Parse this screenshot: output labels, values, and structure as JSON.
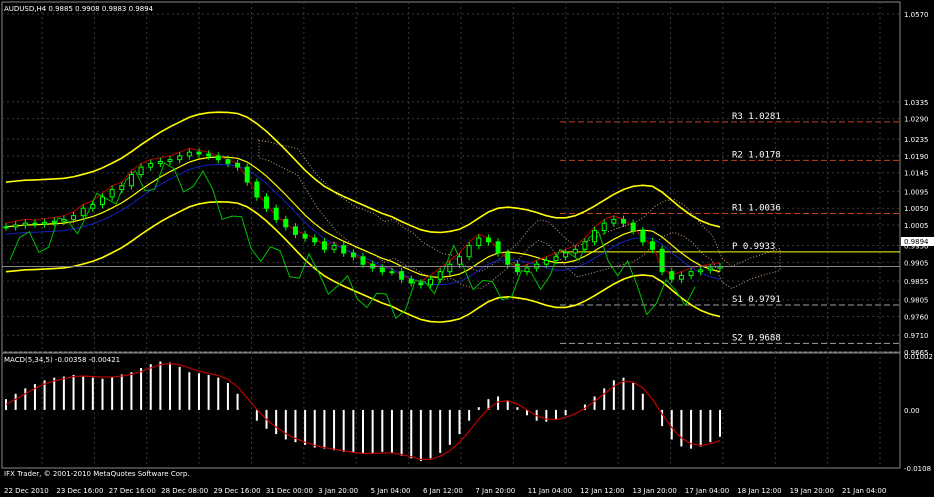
{
  "header": {
    "symbol_line": "AUDUSD,H4  0.9885 0.9908 0.9883 0.9894"
  },
  "macd_header": "MACD(5,34,5) -0.00358 -0.00421",
  "copyright": "IFX Trader, © 2001-2010 MetaQuotes Software Corp.",
  "current_price_label": "0.9894",
  "colors": {
    "background": "#000000",
    "grid": "#3a3a3a",
    "candle": "#00ff00",
    "bollinger": "#ffff00",
    "ichimoku_cloud": "#c8a080",
    "chikou": "#00c000",
    "tenkan": "#c00000",
    "kijun": "#1020c0",
    "pivot_resistance": "#c04020",
    "pivot_support": "#a0a0a0",
    "pivot_p": "#ffff00",
    "macd_hist": "#ffffff",
    "macd_signal": "#c00000"
  },
  "chart_data": [
    {
      "type": "line",
      "title": "AUDUSD,H4",
      "y_ticks": [
        "1.0570",
        "1.0335",
        "1.0290",
        "1.0235",
        "1.0190",
        "1.0145",
        "1.0095",
        "1.0050",
        "1.0005",
        "0.9950",
        "0.9905",
        "0.9855",
        "0.9805",
        "0.9760",
        "0.9710",
        "0.9665"
      ],
      "ylim": [
        0.9665,
        1.057
      ],
      "x_ticks": [
        "22 Dec 2010",
        "23 Dec 16:00",
        "27 Dec 16:00",
        "28 Dec 08:00",
        "29 Dec 16:00",
        "31 Dec 00:00",
        "3 Jan 20:00",
        "5 Jan 04:00",
        "6 Jan 12:00",
        "7 Jan 20:00",
        "11 Jan 04:00",
        "12 Jan 12:00",
        "13 Jan 20:00",
        "17 Jan 04:00",
        "18 Jan 12:00",
        "19 Jan 20:00",
        "21 Jan 04:00"
      ],
      "pivots": [
        {
          "name": "R3",
          "value": "1.0281"
        },
        {
          "name": "R2",
          "value": "1.0178"
        },
        {
          "name": "R1",
          "value": "1.0036"
        },
        {
          "name": "P",
          "value": "0.9933"
        },
        {
          "name": "S1",
          "value": "0.9791"
        },
        {
          "name": "S2",
          "value": "0.9688"
        }
      ],
      "close_series": [
        1.0,
        1.0005,
        1.001,
        1.0008,
        1.0012,
        1.0015,
        1.002,
        1.003,
        1.005,
        1.006,
        1.008,
        1.01,
        1.011,
        1.014,
        1.016,
        1.017,
        1.0175,
        1.018,
        1.019,
        1.02,
        1.0195,
        1.019,
        1.018,
        1.017,
        1.016,
        1.012,
        1.008,
        1.005,
        1.002,
        1.0,
        0.998,
        0.997,
        0.996,
        0.994,
        0.995,
        0.993,
        0.992,
        0.99,
        0.989,
        0.988,
        0.988,
        0.986,
        0.985,
        0.9845,
        0.986,
        0.988,
        0.99,
        0.992,
        0.995,
        0.997,
        0.996,
        0.993,
        0.99,
        0.988,
        0.989,
        0.99,
        0.991,
        0.992,
        0.993,
        0.994,
        0.996,
        0.999,
        1.001,
        1.002,
        1.001,
        0.999,
        0.996,
        0.994,
        0.988,
        0.986,
        0.987,
        0.988,
        0.9885,
        0.989,
        0.9894
      ],
      "current": 0.9894
    },
    {
      "type": "bar",
      "title": "MACD(5,34,5)",
      "y_ticks": [
        "0.01002",
        "0.00",
        "-0.0108"
      ],
      "ylim": [
        -0.0108,
        0.01002
      ],
      "histogram": [
        0.002,
        0.003,
        0.004,
        0.0048,
        0.0055,
        0.006,
        0.0062,
        0.0065,
        0.0063,
        0.006,
        0.0058,
        0.0062,
        0.0066,
        0.007,
        0.0078,
        0.0085,
        0.009,
        0.0088,
        0.008,
        0.007,
        0.0068,
        0.0065,
        0.006,
        0.005,
        0.003,
        0.0,
        -0.002,
        -0.0035,
        -0.0045,
        -0.0055,
        -0.006,
        -0.0065,
        -0.007,
        -0.0072,
        -0.0075,
        -0.0078,
        -0.008,
        -0.0082,
        -0.008,
        -0.0078,
        -0.008,
        -0.0085,
        -0.009,
        -0.0095,
        -0.009,
        -0.008,
        -0.0065,
        -0.0045,
        -0.002,
        0.0005,
        0.002,
        0.0025,
        0.0018,
        0.0005,
        -0.001,
        -0.002,
        -0.0022,
        -0.0018,
        -0.001,
        0.0,
        0.001,
        0.0025,
        0.004,
        0.0055,
        0.006,
        0.005,
        0.003,
        0.0,
        -0.003,
        -0.0055,
        -0.0068,
        -0.0072,
        -0.0068,
        -0.006,
        -0.005
      ],
      "signal": [
        0.001,
        0.002,
        0.003,
        0.004,
        0.0048,
        0.0054,
        0.0058,
        0.0062,
        0.0063,
        0.0062,
        0.0061,
        0.0061,
        0.0063,
        0.0066,
        0.0071,
        0.0078,
        0.0084,
        0.0086,
        0.0084,
        0.0078,
        0.0072,
        0.0068,
        0.0064,
        0.0057,
        0.0043,
        0.0022,
        0.0001,
        -0.0018,
        -0.0032,
        -0.0044,
        -0.0053,
        -0.006,
        -0.0066,
        -0.007,
        -0.0073,
        -0.0076,
        -0.0079,
        -0.0081,
        -0.0081,
        -0.008,
        -0.008,
        -0.0083,
        -0.0087,
        -0.0092,
        -0.0092,
        -0.0086,
        -0.0076,
        -0.006,
        -0.004,
        -0.0017,
        0.0002,
        0.0015,
        0.0017,
        0.0011,
        0.0,
        -0.0011,
        -0.0017,
        -0.0018,
        -0.0014,
        -0.0007,
        0.0003,
        0.0016,
        0.003,
        0.0044,
        0.0053,
        0.0052,
        0.0041,
        0.002,
        -0.0008,
        -0.0033,
        -0.0052,
        -0.0063,
        -0.0066,
        -0.0063,
        -0.0057
      ]
    }
  ]
}
